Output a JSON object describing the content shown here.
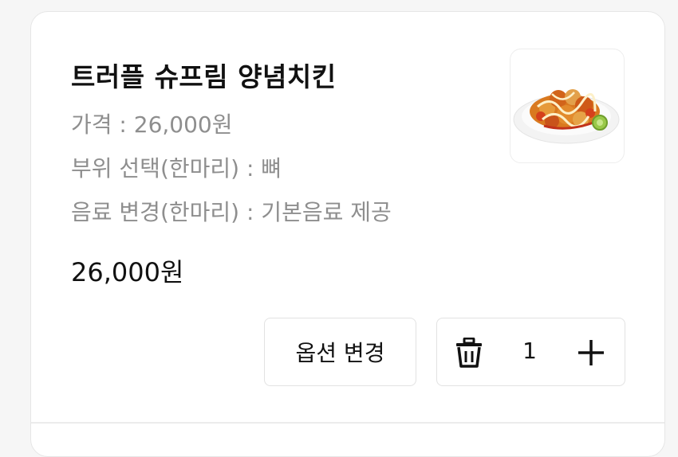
{
  "item": {
    "title": "트러플 슈프림 양념치킨",
    "options": {
      "price": "가격 : 26,000원",
      "part": "부위 선택(한마리) : 뼈",
      "drink": "음료 변경(한마리) : 기본음료 제공"
    },
    "total": "26,000원",
    "image_icon": "chicken-dish-image"
  },
  "actions": {
    "change_option_label": "옵션 변경",
    "quantity": "1",
    "delete_icon": "trash-icon",
    "add_icon": "plus-icon"
  },
  "colors": {
    "title": "#111111",
    "option_text": "#8e8e8e",
    "border": "#e2e2e2"
  }
}
